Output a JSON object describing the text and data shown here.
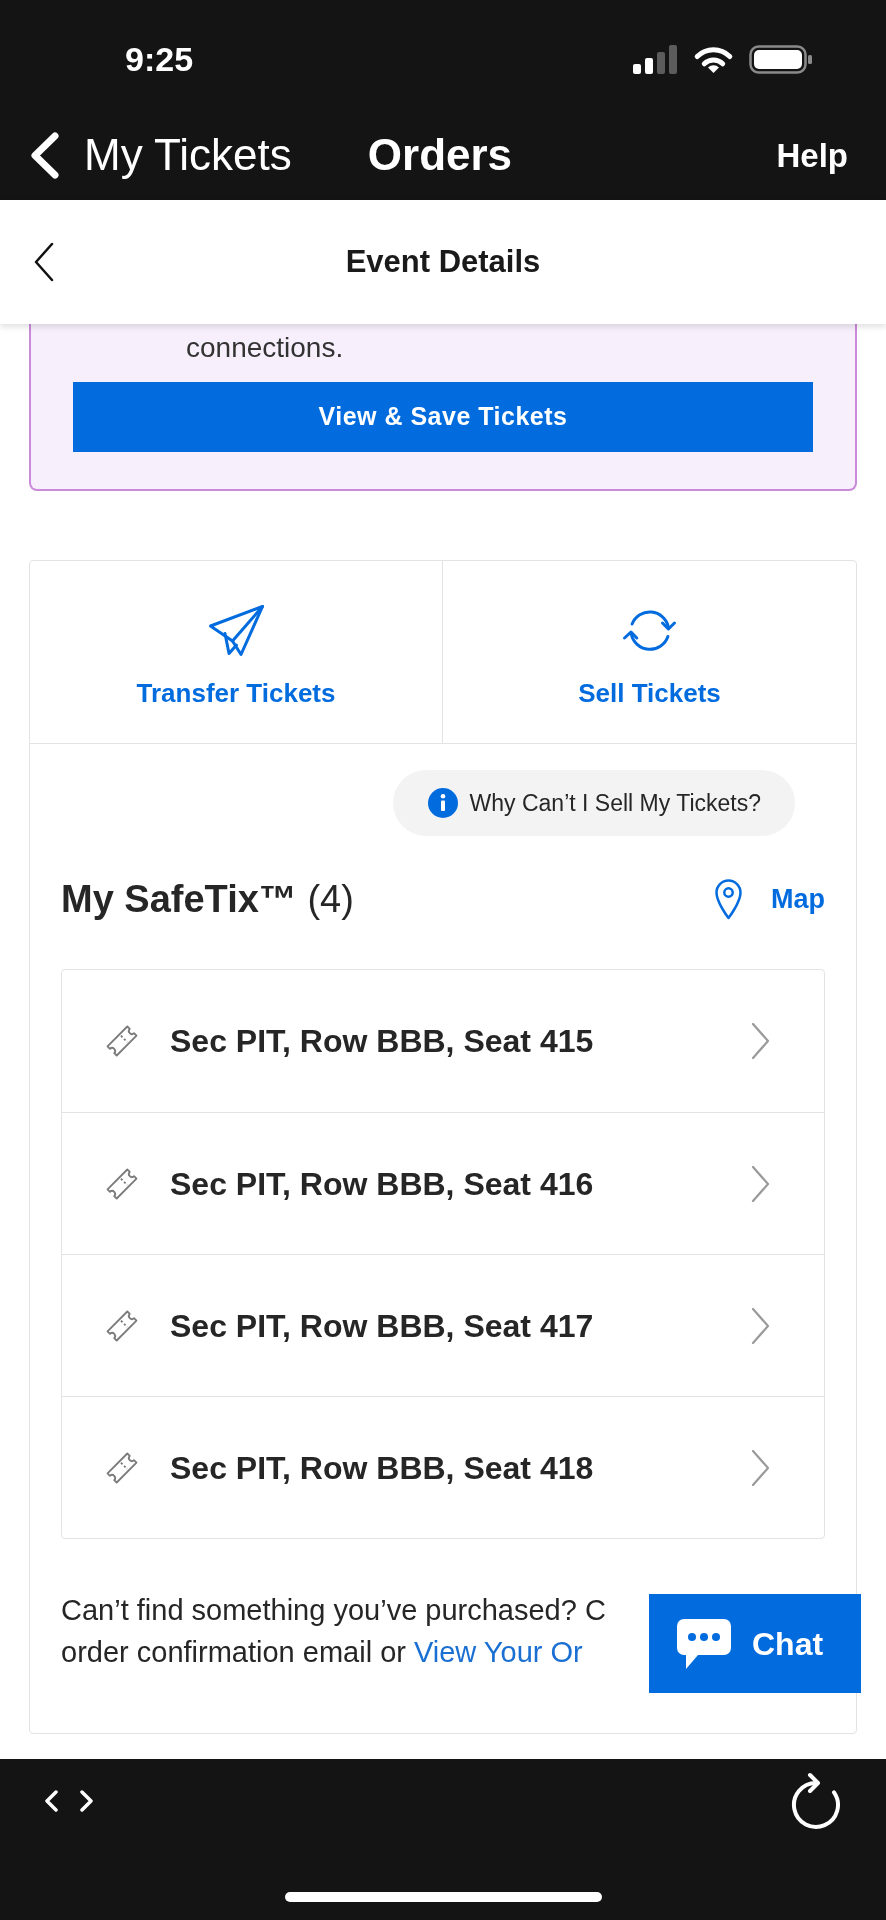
{
  "status_bar": {
    "time": "9:25"
  },
  "nav_bar": {
    "back_label": "My Tickets",
    "title": "Orders",
    "help": "Help"
  },
  "page_header": {
    "title": "Event Details"
  },
  "notice_card": {
    "text": "connections.",
    "button": "View & Save Tickets"
  },
  "ticket_actions": [
    {
      "kind": "transfer",
      "label": "Transfer Tickets"
    },
    {
      "kind": "sell",
      "label": "Sell Tickets"
    }
  ],
  "info_button": "Why Can’t I Sell My Tickets?",
  "safetix": {
    "heading": "**My SafeTix™** (4)",
    "map_link": "Map",
    "tickets": [
      {
        "label": "Sec PIT, Row BBB, Seat 415"
      },
      {
        "label": "Sec PIT, Row BBB, Seat 416"
      },
      {
        "label": "Sec PIT, Row BBB, Seat 417"
      },
      {
        "label": "Sec PIT, Row BBB, Seat 418"
      }
    ]
  },
  "help_note": {
    "line_1": "Can’t find something you’ve purchased? C",
    "line_2": "order confirmation email or",
    "link": "View Your Or"
  },
  "chat_button": "Chat"
}
